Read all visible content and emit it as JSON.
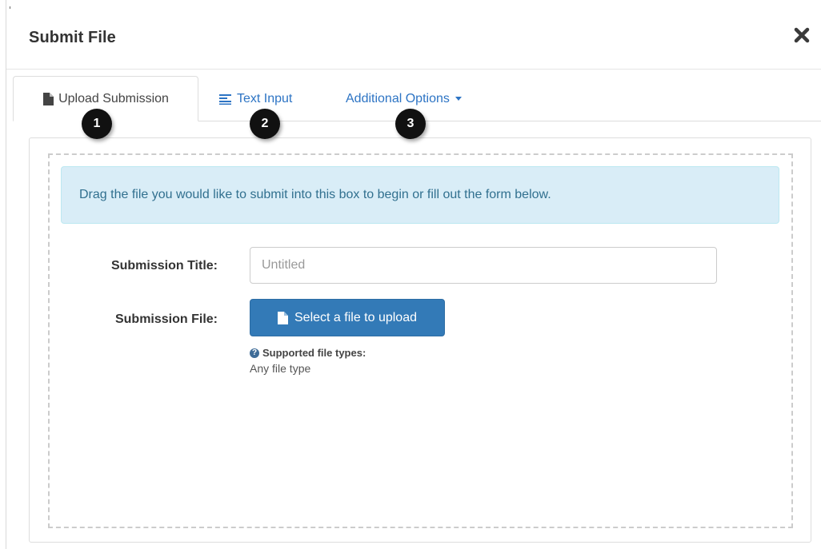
{
  "modal": {
    "title": "Submit File",
    "close_icon": "close-icon"
  },
  "tabs": [
    {
      "label": "Upload Submission",
      "icon": "document-icon",
      "active": true,
      "badge": "1"
    },
    {
      "label": "Text Input",
      "icon": "text-lines-icon",
      "active": false,
      "badge": "2"
    },
    {
      "label": "Additional Options",
      "icon": "caret-down-icon",
      "active": false,
      "badge": "3"
    }
  ],
  "dropzone": {
    "instructions": "Drag the file you would like to submit into this box to begin or fill out the form below."
  },
  "form": {
    "title_label": "Submission Title:",
    "title_placeholder": "Untitled",
    "title_value": "",
    "file_label": "Submission File:",
    "file_button": "Select a file to upload",
    "supported_heading": "Supported file types:",
    "supported_value": "Any file type"
  },
  "colors": {
    "link": "#2d74c4",
    "primary_button": "#337ab7",
    "info_background": "#d9edf7",
    "info_text": "#31708f",
    "badge": "#111111"
  }
}
